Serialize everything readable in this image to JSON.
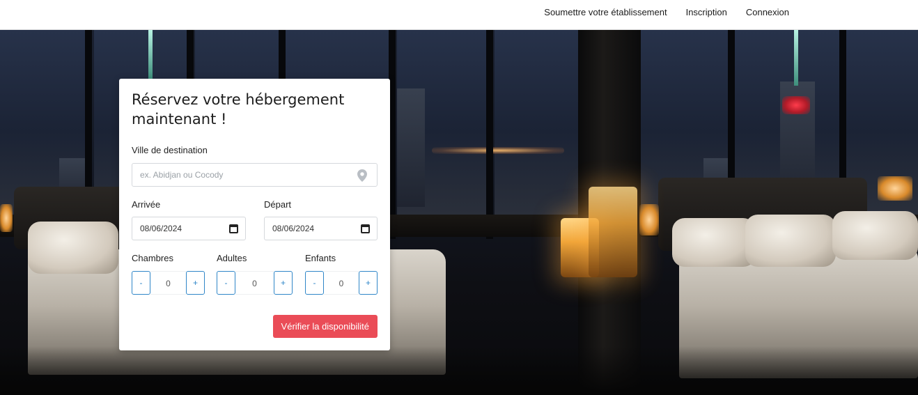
{
  "nav": {
    "submit_listing": "Soumettre votre établissement",
    "register": "Inscription",
    "login": "Connexion"
  },
  "booking": {
    "title": "Réservez votre hébergement maintenant !",
    "destination_label": "Ville de destination",
    "destination_placeholder": "ex. Abidjan ou Cocody",
    "arrival_label": "Arrivée",
    "arrival_value": "08/06/2024",
    "departure_label": "Départ",
    "departure_value": "08/06/2024",
    "rooms_label": "Chambres",
    "adults_label": "Adultes",
    "children_label": "Enfants",
    "rooms_value": "0",
    "adults_value": "0",
    "children_value": "0",
    "minus": "-",
    "plus": "+",
    "submit_label": "Vérifier la disponibilité"
  },
  "icons": {
    "destination": "map-pin-icon",
    "date": "calendar-icon"
  },
  "colors": {
    "accent_button": "#ea4c57",
    "stepper_border": "#2f86c8"
  }
}
